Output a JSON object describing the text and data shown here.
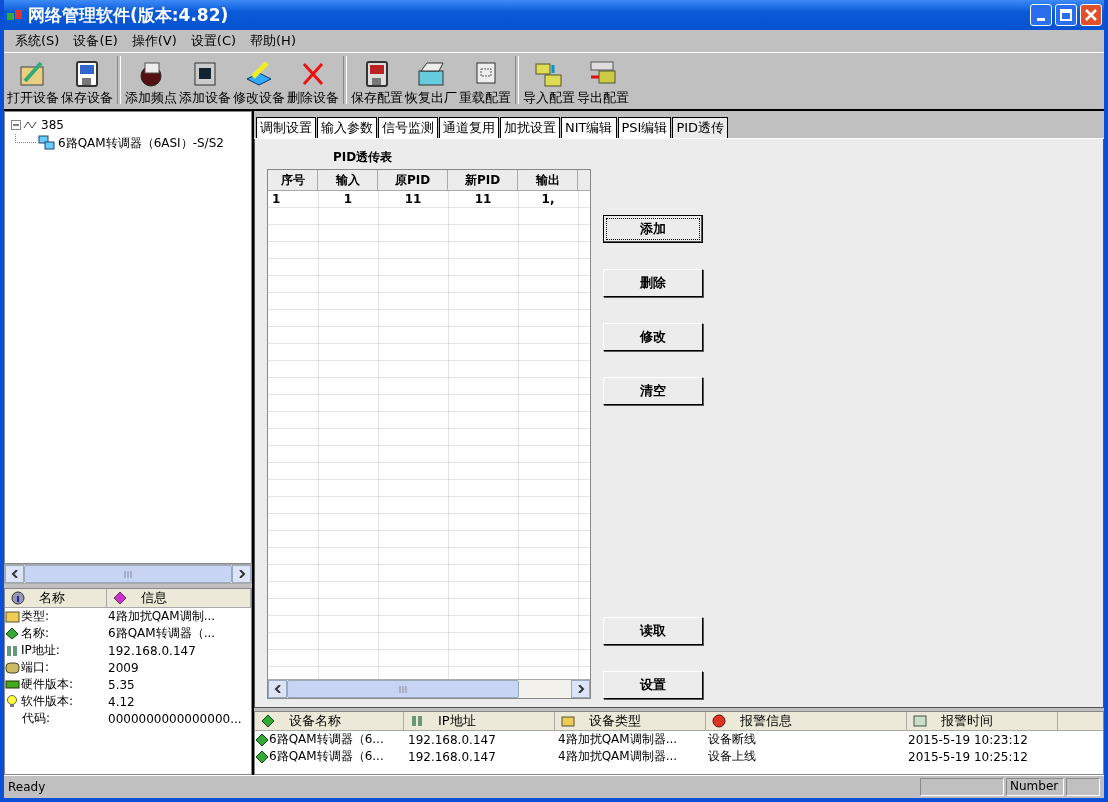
{
  "window": {
    "title": "网络管理软件(版本:4.82)"
  },
  "menu": [
    "系统(S)",
    "设备(E)",
    "操作(V)",
    "设置(C)",
    "帮助(H)"
  ],
  "toolbar": [
    [
      "打开设备",
      "保存设备"
    ],
    [
      "添加频点",
      "添加设备",
      "修改设备",
      "删除设备"
    ],
    [
      "保存配置",
      "恢复出厂",
      "重载配置"
    ],
    [
      "导入配置",
      "导出配置"
    ]
  ],
  "tree": [
    {
      "label": "385",
      "expanded": true,
      "children": [
        {
          "label": "6路QAM转调器（6ASI）-S/S2"
        }
      ]
    }
  ],
  "info_list": {
    "columns": [
      "名称",
      "信息"
    ],
    "rows": [
      {
        "name": "类型:",
        "value": "4路加扰QAM调制..."
      },
      {
        "name": "名称:",
        "value": "6路QAM转调器（..."
      },
      {
        "name": "IP地址:",
        "value": "192.168.0.147"
      },
      {
        "name": "端口:",
        "value": "2009"
      },
      {
        "name": "硬件版本:",
        "value": "5.35"
      },
      {
        "name": "软件版本:",
        "value": "4.12"
      },
      {
        "name": "代码:",
        "value": "0000000000000000..."
      }
    ]
  },
  "tabs": [
    {
      "label": "调制设置",
      "selected": false
    },
    {
      "label": "输入参数",
      "selected": false
    },
    {
      "label": "信号监测",
      "selected": false
    },
    {
      "label": "通道复用",
      "selected": false
    },
    {
      "label": "加扰设置",
      "selected": false
    },
    {
      "label": "NIT编辑",
      "selected": false
    },
    {
      "label": "PSI编辑",
      "selected": false
    },
    {
      "label": "PID透传",
      "selected": true
    }
  ],
  "pid_table": {
    "title": "PID透传表",
    "columns": [
      "序号",
      "输入",
      "原PID",
      "新PID",
      "输出"
    ],
    "rows": [
      [
        "1",
        "1",
        "11",
        "11",
        "1,"
      ]
    ]
  },
  "buttons": [
    {
      "label": "添加",
      "focused": true
    },
    {
      "label": "删除",
      "focused": false
    },
    {
      "label": "修改",
      "focused": false
    },
    {
      "label": "清空",
      "focused": false
    },
    {
      "label": "读取",
      "focused": false
    },
    {
      "label": "设置",
      "focused": false
    }
  ],
  "alarm_list": {
    "columns": [
      "设备名称",
      "IP地址",
      "设备类型",
      "报警信息",
      "报警时间"
    ],
    "rows": [
      [
        "6路QAM转调器（6...",
        "192.168.0.147",
        "4路加扰QAM调制器...",
        "设备断线",
        "2015-5-19 10:23:12"
      ],
      [
        "6路QAM转调器（6...",
        "192.168.0.147",
        "4路加扰QAM调制器...",
        "设备上线",
        "2015-5-19 10:25:12"
      ]
    ]
  },
  "status_bar": {
    "text": "Ready",
    "indicator": "Number"
  }
}
